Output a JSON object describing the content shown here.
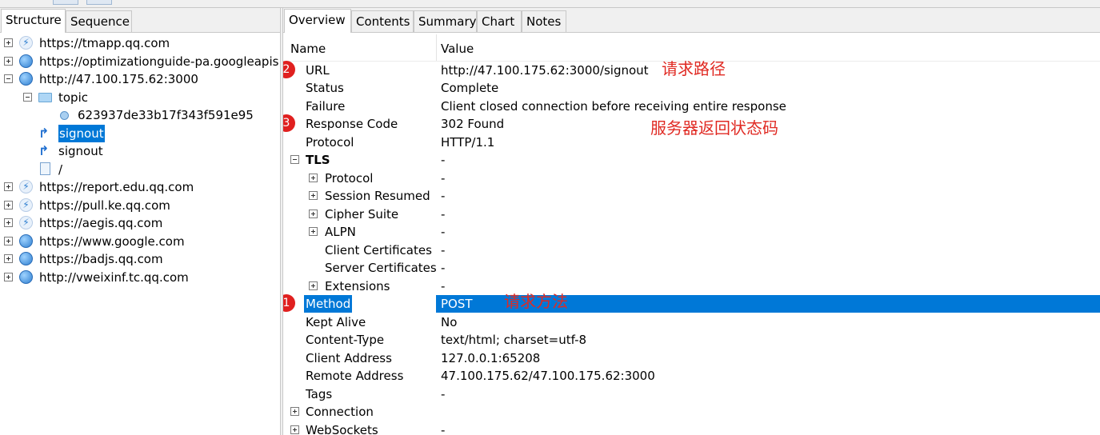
{
  "left_panel": {
    "tabs": [
      "Structure",
      "Sequence"
    ],
    "tree": [
      {
        "label": "https://tmapp.qq.com",
        "icon": "bolt-icon",
        "expander": "plus"
      },
      {
        "label": "https://optimizationguide-pa.googleapis",
        "icon": "globe-icon",
        "expander": "plus"
      },
      {
        "label": "http://47.100.175.62:3000",
        "icon": "globe-icon",
        "expander": "minus"
      },
      {
        "label": "topic",
        "icon": "folder-icon",
        "expander": "minus"
      },
      {
        "label": "623937de33b17f343f591e95",
        "icon": "request-icon",
        "expander": "none"
      },
      {
        "label": "signout",
        "icon": "redirect-icon",
        "expander": "none",
        "selected": true
      },
      {
        "label": "signout",
        "icon": "redirect-icon",
        "expander": "none"
      },
      {
        "label": "/",
        "icon": "page-icon",
        "expander": "none"
      },
      {
        "label": "https://report.edu.qq.com",
        "icon": "bolt-icon",
        "expander": "plus"
      },
      {
        "label": "https://pull.ke.qq.com",
        "icon": "bolt-icon",
        "expander": "plus"
      },
      {
        "label": "https://aegis.qq.com",
        "icon": "bolt-icon",
        "expander": "plus"
      },
      {
        "label": "https://www.google.com",
        "icon": "globe-icon",
        "expander": "plus"
      },
      {
        "label": "https://badjs.qq.com",
        "icon": "globe-icon",
        "expander": "plus"
      },
      {
        "label": "http://vweixinf.tc.qq.com",
        "icon": "globe-icon",
        "expander": "plus"
      }
    ]
  },
  "right_panel": {
    "tabs": [
      "Overview",
      "Contents",
      "Summary",
      "Chart",
      "Notes"
    ],
    "header": {
      "name": "Name",
      "value": "Value"
    },
    "rows": [
      {
        "name": "URL",
        "value": "http://47.100.175.62:3000/signout"
      },
      {
        "name": "Status",
        "value": "Complete"
      },
      {
        "name": "Failure",
        "value": "Client closed connection before receiving entire response"
      },
      {
        "name": "Response Code",
        "value": "302 Found"
      },
      {
        "name": "Protocol",
        "value": "HTTP/1.1"
      },
      {
        "name": "TLS",
        "value": "-",
        "bold": true,
        "expander": "minus"
      },
      {
        "name": "Protocol",
        "value": "-",
        "expander": "plus",
        "indent": 1
      },
      {
        "name": "Session Resumed",
        "value": "-",
        "expander": "plus",
        "indent": 1
      },
      {
        "name": "Cipher Suite",
        "value": "-",
        "expander": "plus",
        "indent": 1
      },
      {
        "name": "ALPN",
        "value": "-",
        "expander": "plus",
        "indent": 1
      },
      {
        "name": "Client Certificates",
        "value": "-",
        "indent": 1
      },
      {
        "name": "Server Certificates",
        "value": "-",
        "indent": 1
      },
      {
        "name": "Extensions",
        "value": "-",
        "expander": "plus",
        "indent": 1
      },
      {
        "name": "Method",
        "value": "POST",
        "selected": true
      },
      {
        "name": "Kept Alive",
        "value": "No"
      },
      {
        "name": "Content-Type",
        "value": "text/html; charset=utf-8"
      },
      {
        "name": "Client Address",
        "value": "127.0.0.1:65208"
      },
      {
        "name": "Remote Address",
        "value": "47.100.175.62/47.100.175.62:3000"
      },
      {
        "name": "Tags",
        "value": "-"
      },
      {
        "name": "Connection",
        "value": "",
        "expander": "plus",
        "outdent": true
      },
      {
        "name": "WebSockets",
        "value": "-",
        "expander": "plus",
        "outdent": true
      }
    ]
  },
  "annotations": {
    "badges": [
      {
        "text": "2",
        "row": 0
      },
      {
        "text": "3",
        "row": 3
      },
      {
        "text": "1",
        "row": 13
      }
    ],
    "notes": [
      {
        "text": "请求路径",
        "row": 0
      },
      {
        "text": "服务器返回状态码",
        "row": 3
      },
      {
        "text": "请求方法",
        "row": 13
      }
    ],
    "color": "#e02a23"
  },
  "colors": {
    "selection": "#0078d7"
  }
}
